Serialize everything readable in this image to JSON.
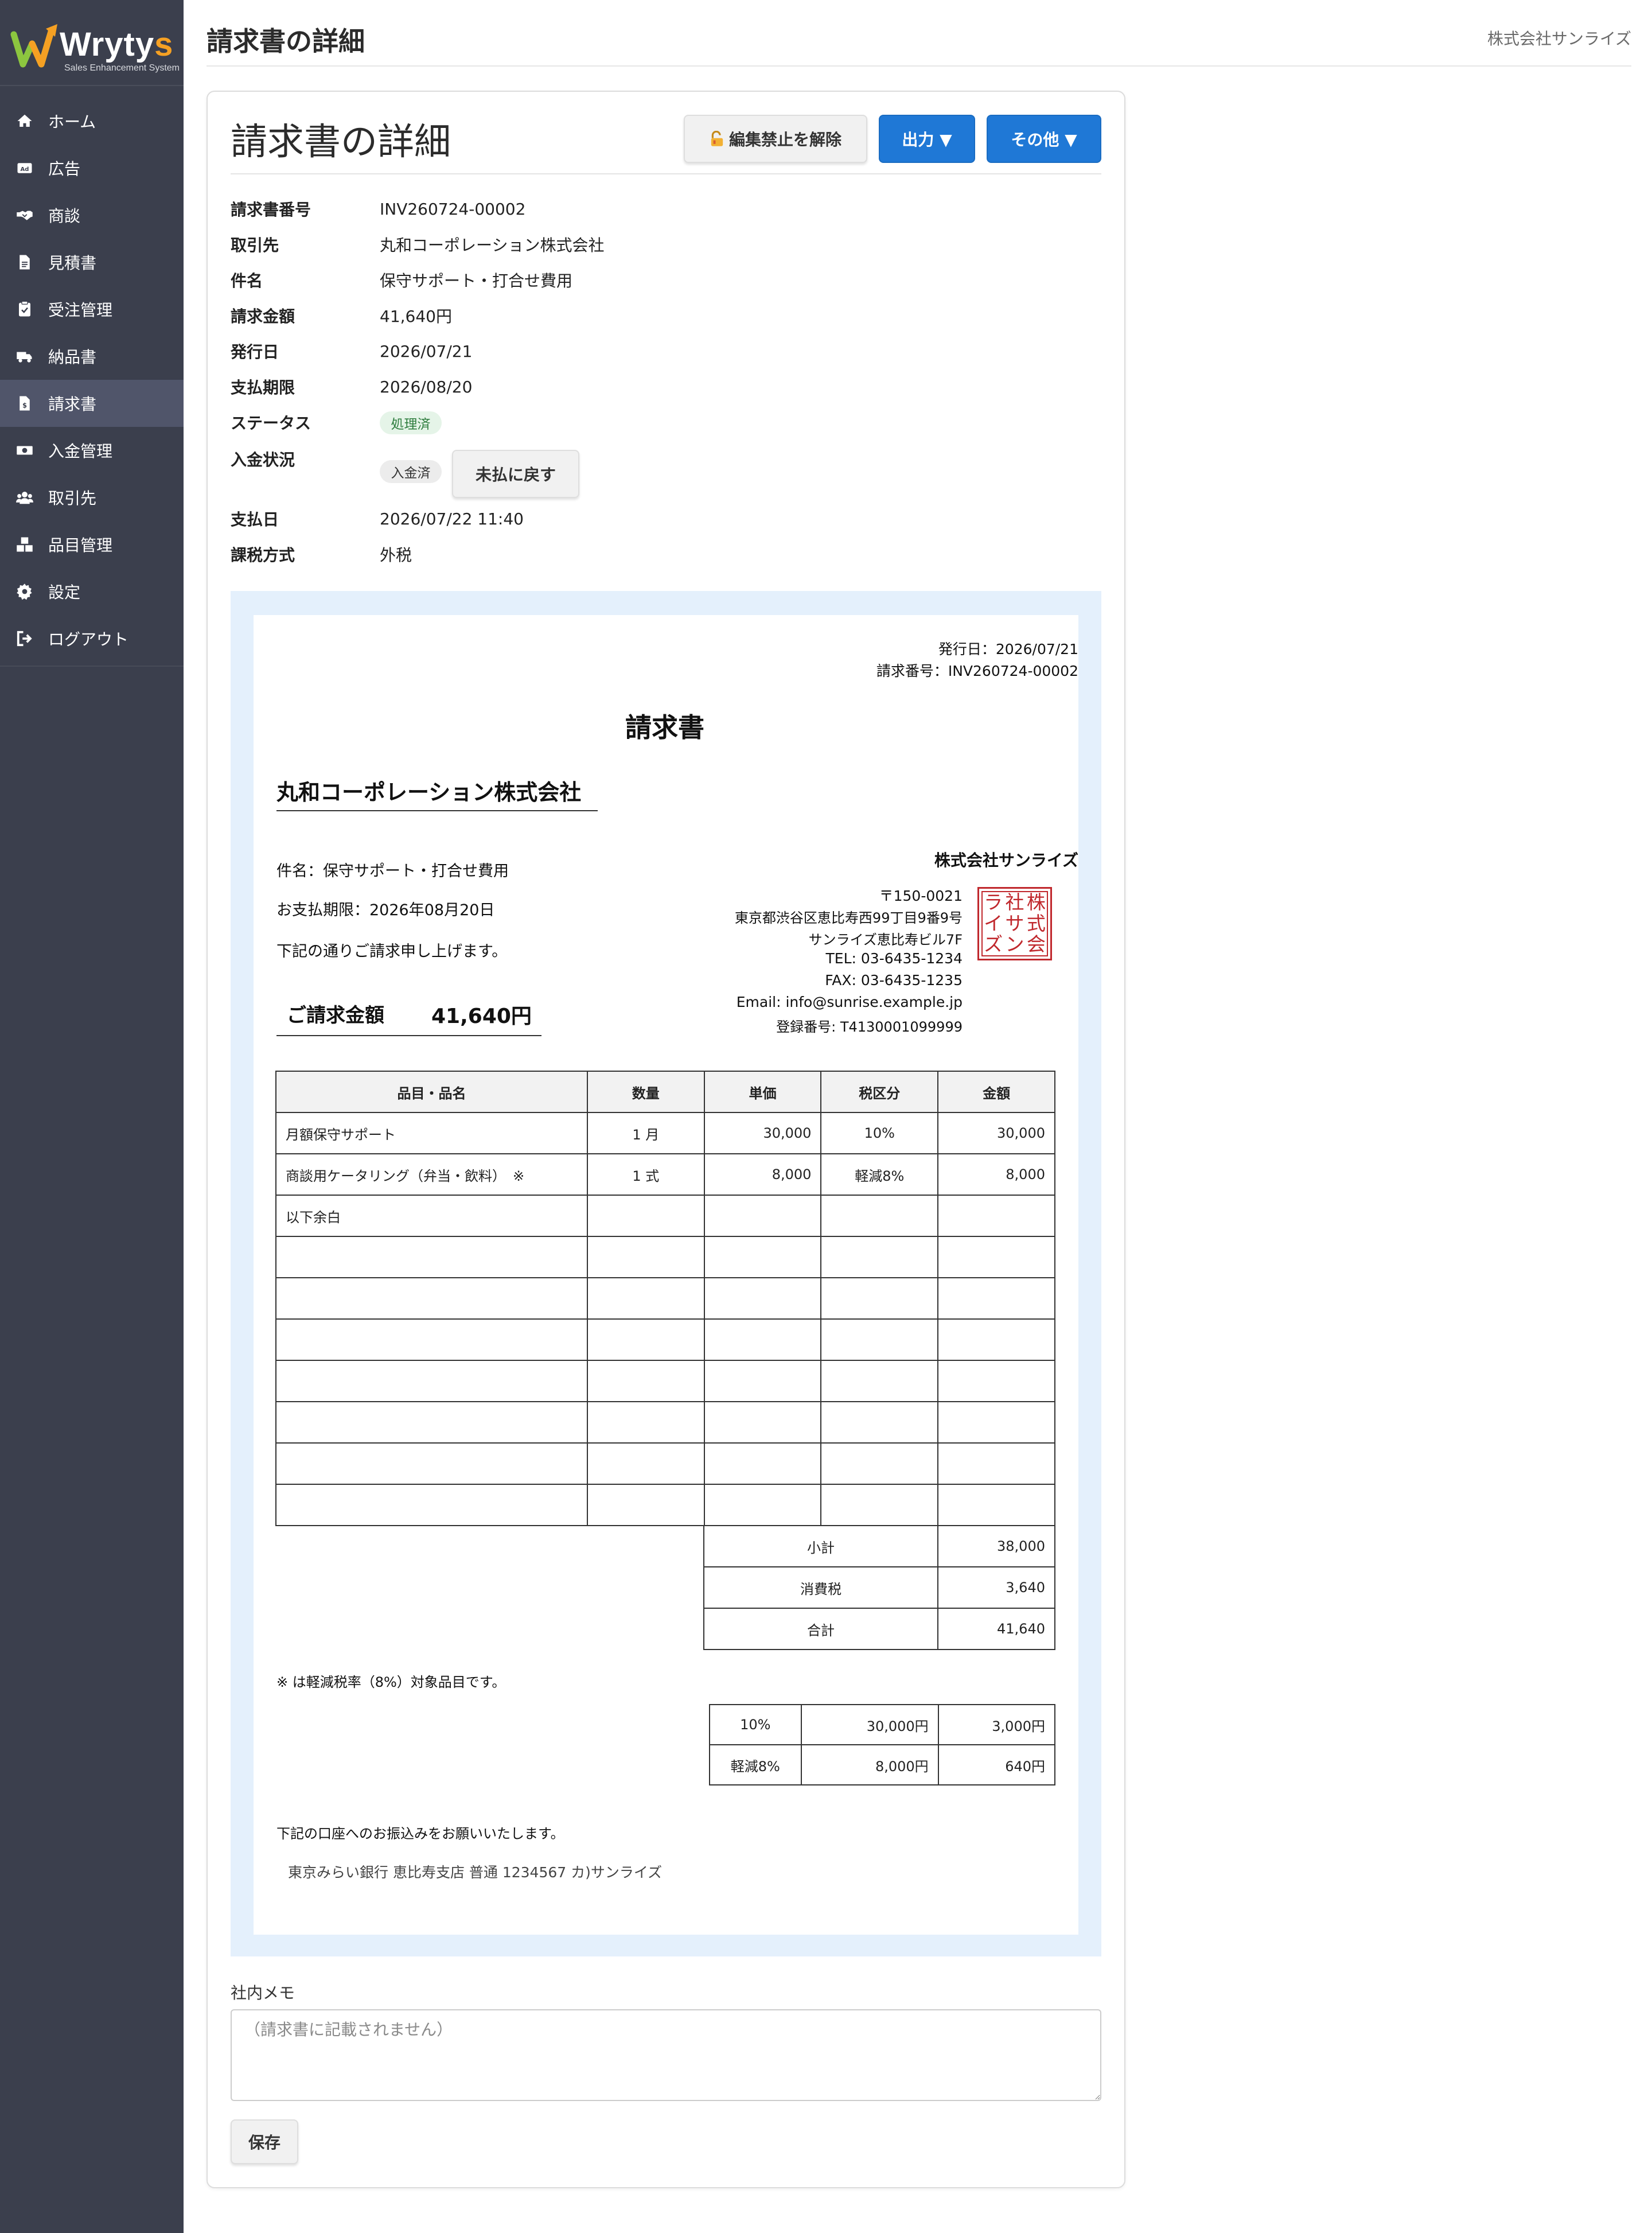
{
  "brand": {
    "name_main": "Wryty",
    "name_accent": "s",
    "tagline": "Sales Enhancement System"
  },
  "sidebar": {
    "items": [
      {
        "label": "ホーム",
        "icon": "home-icon"
      },
      {
        "label": "広告",
        "icon": "ad-icon"
      },
      {
        "label": "商談",
        "icon": "handshake-icon"
      },
      {
        "label": "見積書",
        "icon": "document-icon"
      },
      {
        "label": "受注管理",
        "icon": "clipboard-check-icon"
      },
      {
        "label": "納品書",
        "icon": "truck-icon"
      },
      {
        "label": "請求書",
        "icon": "invoice-icon",
        "active": true
      },
      {
        "label": "入金管理",
        "icon": "money-icon"
      },
      {
        "label": "取引先",
        "icon": "users-icon"
      },
      {
        "label": "品目管理",
        "icon": "boxes-icon"
      },
      {
        "label": "設定",
        "icon": "gear-icon"
      },
      {
        "label": "ログアウト",
        "icon": "logout-icon"
      }
    ]
  },
  "header": {
    "title": "請求書の詳細",
    "company": "株式会社サンライズ"
  },
  "card": {
    "title": "請求書の詳細",
    "buttons": {
      "unlock": "編集禁止を解除",
      "output": "出力 ▼",
      "other": "その他 ▼"
    }
  },
  "details": [
    {
      "label": "請求書番号",
      "value": "INV260724-00002"
    },
    {
      "label": "取引先",
      "value": "丸和コーポレーション株式会社"
    },
    {
      "label": "件名",
      "value": "保守サポート・打合せ費用"
    },
    {
      "label": "請求金額",
      "value": "41,640円"
    },
    {
      "label": "発行日",
      "value": "2026/07/21"
    },
    {
      "label": "支払期限",
      "value": "2026/08/20"
    },
    {
      "label": "ステータス",
      "value": "処理済"
    },
    {
      "label": "入金状況",
      "value": "入金済"
    },
    {
      "label": "支払日",
      "value": "2026/07/22 11:40"
    },
    {
      "label": "課税方式",
      "value": "外税"
    }
  ],
  "unpaid_button": "未払に戻す",
  "invoice": {
    "issue_date_line": "発行日：2026/07/21",
    "number_line": "請求番号：INV260724-00002",
    "heading": "請求書",
    "customer": "丸和コーポレーション株式会社",
    "subject_line": "件名：保守サポート・打合せ費用",
    "due_line": "お支払期限：2026年08月20日",
    "greeting": "下記の通りご請求申し上げます。",
    "amount_label": "ご請求金額",
    "amount_value": "41,640円",
    "seller": {
      "name": "株式会社サンライズ",
      "postal": "〒150-0021",
      "address1": "東京都渋谷区恵比寿西99丁目9番9号",
      "address2": "サンライズ恵比寿ビル7F",
      "tel": "TEL: 03-6435-1234",
      "fax": "FAX: 03-6435-1235",
      "email": "Email: info@sunrise.example.jp",
      "reg": "登録番号: T4130001099999",
      "stamp_chars": [
        "ラ",
        "社",
        "株",
        "イ",
        "サ",
        "式",
        "ズ",
        "ン",
        "会"
      ]
    },
    "table_headers": [
      "品目・品名",
      "数量",
      "単価",
      "税区分",
      "金額"
    ],
    "rows": [
      [
        "月額保守サポート",
        "1 月",
        "30,000",
        "10%",
        "30,000"
      ],
      [
        "商談用ケータリング（弁当・飲料）　※",
        "1 式",
        "8,000",
        "軽減8%",
        "8,000"
      ],
      [
        "以下余白",
        "",
        "",
        "",
        ""
      ],
      [
        "",
        "",
        "",
        "",
        ""
      ],
      [
        "",
        "",
        "",
        "",
        ""
      ],
      [
        "",
        "",
        "",
        "",
        ""
      ],
      [
        "",
        "",
        "",
        "",
        ""
      ],
      [
        "",
        "",
        "",
        "",
        ""
      ],
      [
        "",
        "",
        "",
        "",
        ""
      ],
      [
        "",
        "",
        "",
        "",
        ""
      ]
    ],
    "totals": [
      {
        "label": "小計",
        "value": "38,000"
      },
      {
        "label": "消費税",
        "value": "3,640"
      },
      {
        "label": "合計",
        "value": "41,640"
      }
    ],
    "note": "※ は軽減税率（8%）対象品目です。",
    "tax_summary": [
      [
        "10%",
        "30,000円",
        "3,000円"
      ],
      [
        "軽減8%",
        "8,000円",
        "640円"
      ]
    ],
    "bank_lead": "下記の口座へのお振込みをお願いいたします。",
    "bank": "東京みらい銀行 恵比寿支店 普通 1234567 カ)サンライズ"
  },
  "memo": {
    "label": "社内メモ",
    "placeholder": "（請求書に記載されません）",
    "value": ""
  },
  "save_button": "保存",
  "colors": {
    "sidebar": "#3b3f4d",
    "accent": "#f5a023",
    "primary": "#1f78d6",
    "stamp": "#c0282d"
  }
}
